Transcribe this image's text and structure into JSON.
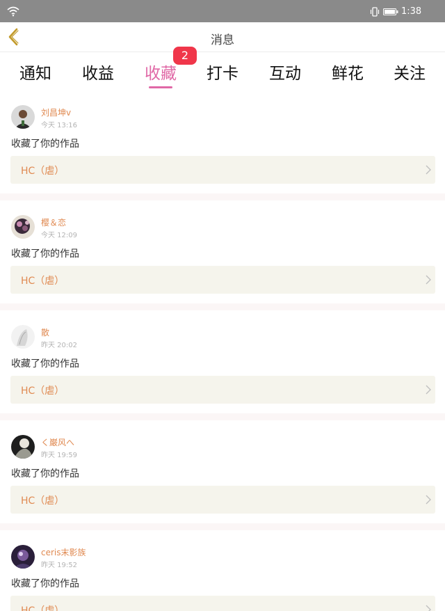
{
  "status_bar": {
    "time": "1:38",
    "icons": [
      "wifi-icon",
      "vibrate-icon",
      "battery-icon"
    ]
  },
  "header": {
    "title": "消息",
    "back_icon": "chevron-left-icon"
  },
  "tabs": [
    {
      "label": "通知"
    },
    {
      "label": "收益"
    },
    {
      "label": "收藏",
      "active": true,
      "badge": "2"
    },
    {
      "label": "打卡"
    },
    {
      "label": "互动"
    },
    {
      "label": "鲜花"
    },
    {
      "label": "关注"
    }
  ],
  "colors": {
    "accent": "#e068a6",
    "badge": "#f0364a",
    "username": "#e08a52",
    "work_bg": "#f5f4ec"
  },
  "notifications": [
    {
      "user": "刘昌坤v",
      "time": "今天 13:16",
      "action": "收藏了你的作品",
      "work": "HC（虐）"
    },
    {
      "user": "樱＆恋",
      "time": "今天 12:09",
      "action": "收藏了你的作品",
      "work": "HC（虐）"
    },
    {
      "user": "散",
      "time": "昨天 20:02",
      "action": "收藏了你的作品",
      "work": "HC（虐）"
    },
    {
      "user": "く巌风へ",
      "time": "昨天 19:59",
      "action": "收藏了你的作品",
      "work": "HC（虐）"
    },
    {
      "user": "ceris末影族",
      "time": "昨天 19:52",
      "action": "收藏了你的作品",
      "work": "HC（虐）"
    }
  ]
}
